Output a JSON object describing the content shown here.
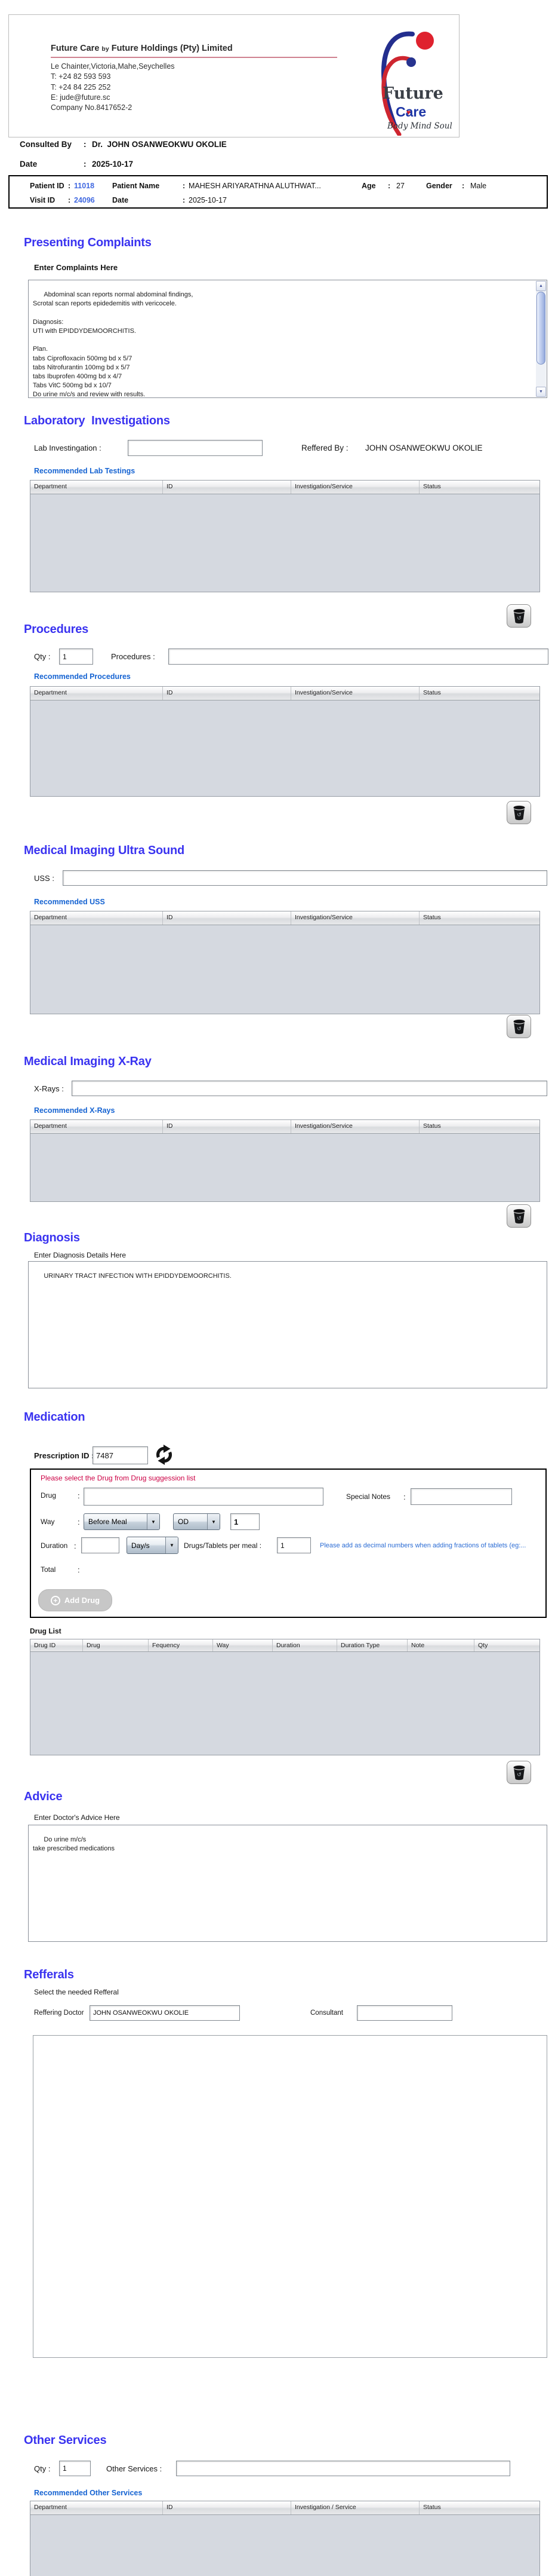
{
  "ui": {
    "colon": ":"
  },
  "header": {
    "title_main": "Future Care",
    "title_by": "by",
    "title_rest": "Future Holdings (Pty) Limited",
    "address": [
      "Le Chainter,Victoria,Mahe,Seychelles",
      "T: +24  82 593 593",
      "T: +24  84 225 252",
      "E: jude@future.sc",
      "Company No.8417652-2"
    ],
    "logo": {
      "word1": "Future",
      "word2": "Care",
      "tagline": "Body Mind Soul"
    }
  },
  "consult": {
    "consulted_by_label": "Consulted By",
    "consulted_by_value": "Dr.  JOHN OSANWEOKWU OKOLIE",
    "date_label": "Date",
    "date_value": "2025-10-17"
  },
  "patient_bar": {
    "patient_id_label": "Patient ID",
    "patient_id": "11018",
    "patient_name_label": "Patient Name",
    "patient_name": "MAHESH ARIYARATHNA ALUTHWAT...",
    "age_label": "Age",
    "age": "27",
    "gender_label": "Gender",
    "gender": "Male",
    "visit_id_label": "Visit ID",
    "visit_id": "24096",
    "date_label": "Date",
    "date": "2025-10-17"
  },
  "presenting": {
    "title": "Presenting Complaints",
    "sublabel": "Enter Complaints Here",
    "text": "Abdominal scan reports normal abdominal findings,\nScrotal scan reports epidedemitis with vericocele.\n\nDiagnosis:\nUTI with EPIDDYDEMOORCHITIS.\n\nPlan.\ntabs Ciprofloxacin 500mg bd x 5/7\ntabs Nitrofurantin 100mg bd x 5/7\ntabs Ibuprofen 400mg bd x 4/7\nTabs VitC 500mg bd x 10/7\nDo urine m/c/s and review with results."
  },
  "lab": {
    "title": "Laboratory  Investigations",
    "label": "Lab Investingation :",
    "referred_label": "Reffered By :",
    "referred_value": "JOHN OSANWEOKWU OKOLIE",
    "recommended": "Recommended Lab Testings",
    "cols": [
      "Department",
      "ID",
      "Investigation/Service",
      "Status"
    ]
  },
  "procedures": {
    "title": "Procedures",
    "qty_label": "Qty :",
    "qty_value": "1",
    "label": "Procedures :",
    "recommended": "Recommended Procedures",
    "cols": [
      "Department",
      "ID",
      "Investigation/Service",
      "Status"
    ]
  },
  "uss": {
    "title": "Medical Imaging Ultra Sound",
    "label": "USS :",
    "recommended": "Recommended USS",
    "cols": [
      "Department",
      "ID",
      "Investigation/Service",
      "Status"
    ]
  },
  "xray": {
    "title": "Medical Imaging X-Ray",
    "label": "X-Rays :",
    "recommended": "Recommended X-Rays",
    "cols": [
      "Department",
      "ID",
      "Investigation/Service",
      "Status"
    ]
  },
  "diagnosis": {
    "title": "Diagnosis",
    "sublabel": "Enter Diagnosis Details Here",
    "text": "URINARY TRACT INFECTION WITH EPIDDYDEMOORCHITIS."
  },
  "medication": {
    "title": "Medication",
    "prescription_label": "Prescription ID :",
    "prescription_id": "7487",
    "warning": "Please select the Drug from Drug suggession list",
    "drug_label": "Drug",
    "special_notes_label": "Special Notes",
    "way_label": "Way",
    "meal_value": "Before Meal",
    "freq_value": "OD",
    "way_qty": "1",
    "duration_label": "Duration",
    "duration_unit": "Day/s",
    "per_meal_label": "Drugs/Tablets per meal :",
    "per_meal_value": "1",
    "note": "Please add as decimal numbers when adding fractions of tablets (eg:...",
    "total_label": "Total",
    "add_drug": "Add Drug",
    "drug_list_label": "Drug List",
    "cols": [
      "Drug ID",
      "Drug",
      "Fequency",
      "Way",
      "Duration",
      "Duration Type",
      "Note",
      "Qty"
    ]
  },
  "advice": {
    "title": "Advice",
    "sublabel": "Enter Doctor's Advice Here",
    "text": "Do urine m/c/s\ntake prescribed medications"
  },
  "refferals": {
    "title": "Refferals",
    "sublabel": "Select the needed Refferal",
    "doctor_label": "Reffering Doctor",
    "doctor_value": "JOHN OSANWEOKWU OKOLIE",
    "consultant_label": "Consultant"
  },
  "other": {
    "title": "Other Services",
    "qty_label": "Qty :",
    "qty_value": "1",
    "label": "Other Services :",
    "recommended": "Recommended Other Services",
    "cols": [
      "Department",
      "ID",
      "Investigation / Service",
      "Status"
    ]
  }
}
